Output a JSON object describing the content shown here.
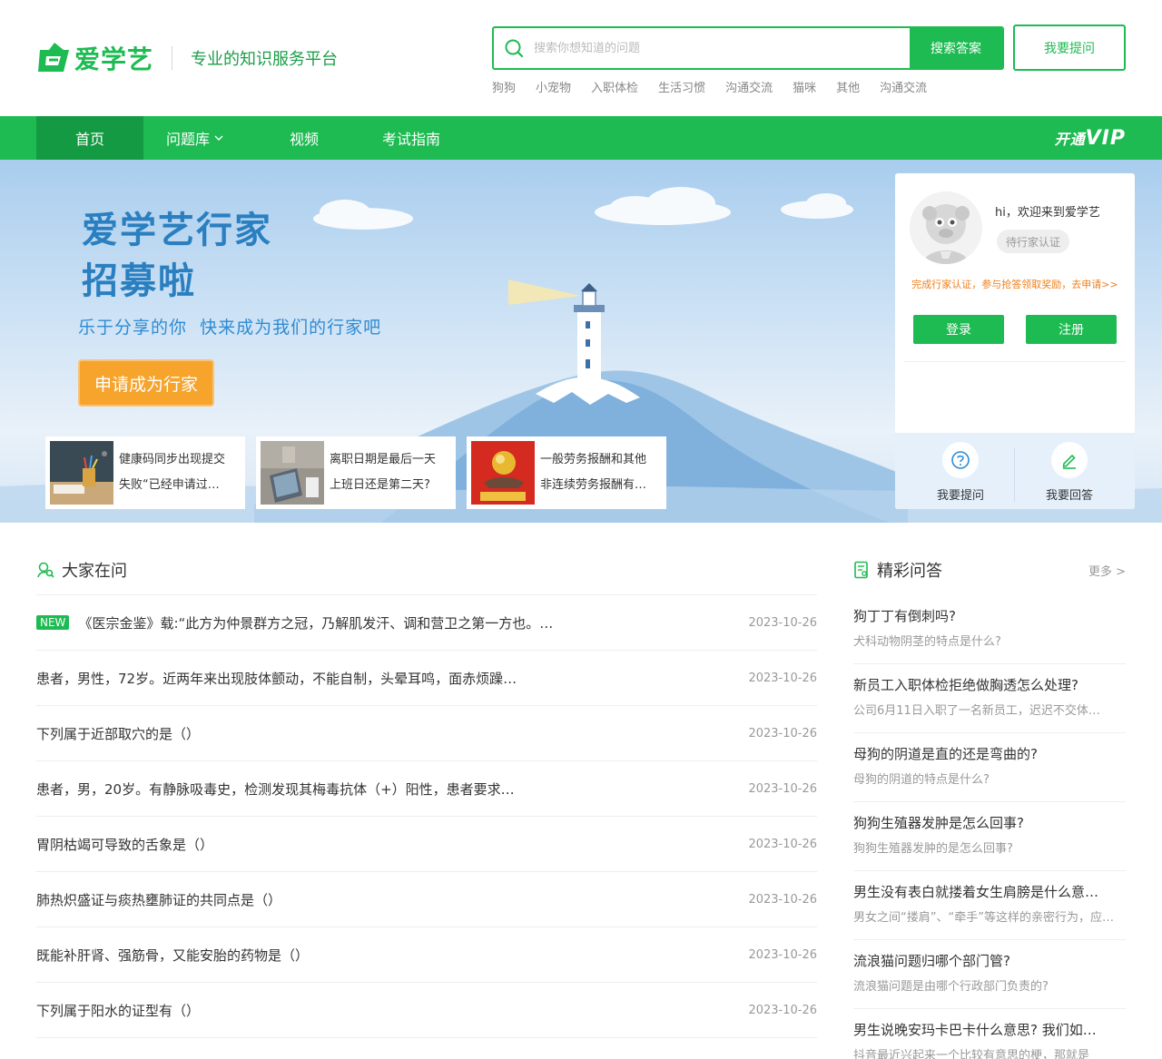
{
  "header": {
    "logo_text": "爱学艺",
    "slogan": "专业的知识服务平台",
    "search_placeholder": "搜索你想知道的问题",
    "search_button": "搜索答案",
    "ask_button": "我要提问",
    "hot_tags": [
      "狗狗",
      "小宠物",
      "入职体检",
      "生活习惯",
      "沟通交流",
      "猫咪",
      "其他",
      "沟通交流"
    ]
  },
  "nav": {
    "items": [
      "首页",
      "问题库",
      "视频",
      "考试指南"
    ],
    "vip_prefix": "开通",
    "vip_text": "VIP"
  },
  "banner": {
    "title_line1": "爱学艺行家",
    "title_line2": "招募啦",
    "subtitle": "乐于分享的你  快来成为我们的行家吧",
    "apply_button": "申请成为行家",
    "cards": [
      {
        "line1": "健康码同步出现提交",
        "line2": "失败“已经申请过…"
      },
      {
        "line1": "离职日期是最后一天",
        "line2": "上班日还是第二天?"
      },
      {
        "line1": "一般劳务报酬和其他",
        "line2": "非连续劳务报酬有…"
      }
    ]
  },
  "user_panel": {
    "welcome": "hi，欢迎来到爱学艺",
    "status": "待行家认证",
    "tip": "完成行家认证，参与抢答领取奖励，去申请>>",
    "login": "登录",
    "register": "注册",
    "ask": "我要提问",
    "answer": "我要回答"
  },
  "questions": {
    "title": "大家在问",
    "new_tag": "NEW",
    "items": [
      {
        "text": "《医宗金鉴》载:“此方为仲景群方之冠，乃解肌发汗、调和营卫之第一方也。…",
        "date": "2023-10-26"
      },
      {
        "text": "患者，男性，72岁。近两年来出现肢体颤动，不能自制，头晕耳鸣，面赤烦躁…",
        "date": "2023-10-26"
      },
      {
        "text": "下列属于近部取穴的是（）",
        "date": "2023-10-26"
      },
      {
        "text": "患者，男，20岁。有静脉吸毒史，检测发现其梅毒抗体（+）阳性，患者要求…",
        "date": "2023-10-26"
      },
      {
        "text": "胃阴枯竭可导致的舌象是（）",
        "date": "2023-10-26"
      },
      {
        "text": "肺热炽盛证与痰热壅肺证的共同点是（）",
        "date": "2023-10-26"
      },
      {
        "text": "既能补肝肾、强筋骨，又能安胎的药物是（）",
        "date": "2023-10-26"
      },
      {
        "text": "下列属于阳水的证型有（）",
        "date": "2023-10-26"
      }
    ]
  },
  "answers": {
    "title": "精彩问答",
    "more": "更多 >",
    "items": [
      {
        "q": "狗丁丁有倒刺吗?",
        "a": "犬科动物阴茎的特点是什么?"
      },
      {
        "q": "新员工入职体检拒绝做胸透怎么处理?",
        "a": "公司6月11日入职了一名新员工，迟迟不交体…"
      },
      {
        "q": "母狗的阴道是直的还是弯曲的?",
        "a": "母狗的阴道的特点是什么?"
      },
      {
        "q": "狗狗生殖器发肿是怎么回事?",
        "a": "狗狗生殖器发肿的是怎么回事?"
      },
      {
        "q": "男生没有表白就搂着女生肩膀是什么意…",
        "a": "男女之间“搂肩”、“牵手”等这样的亲密行为，应…"
      },
      {
        "q": "流浪猫问题归哪个部门管?",
        "a": "流浪猫问题是由哪个行政部门负责的?"
      },
      {
        "q": "男生说晚安玛卡巴卡什么意思? 我们如…",
        "a": "抖音最近兴起来一个比较有意思的梗，那就是"
      }
    ]
  },
  "colors": {
    "brand": "#1dbb52",
    "brand_dark": "#149a42",
    "orange": "#f6a42c"
  }
}
